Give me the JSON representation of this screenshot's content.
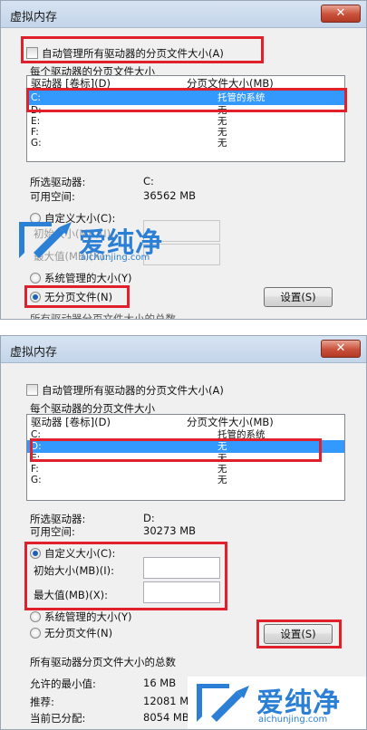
{
  "panel1": {
    "title": "虚拟内存",
    "close_glyph": "✕",
    "auto_manage_label": "自动管理所有驱动器的分页文件大小(A)",
    "group_title": "每个驱动器的分页文件大小",
    "list_head": {
      "drive": "驱动器 [卷标](D)",
      "size": "分页文件大小(MB)"
    },
    "rows": [
      {
        "drive": "C:",
        "size": "托管的系统"
      },
      {
        "drive": "D:",
        "size": "无"
      },
      {
        "drive": "E:",
        "size": "无"
      },
      {
        "drive": "F:",
        "size": "无"
      },
      {
        "drive": "G:",
        "size": "无"
      }
    ],
    "selected_drive_label": "所选驱动器:",
    "selected_drive_value": "C:",
    "free_space_label": "可用空间:",
    "free_space_value": "36562 MB",
    "custom_size_label": "自定义大小(C):",
    "initial_size_label": "初始大小(MB)(I):",
    "max_size_label": "最大值(MB)(X):",
    "system_managed_label": "系统管理的大小(Y)",
    "no_paging_label": "无分页文件(N)",
    "set_button": "设置(S)",
    "cutoff_text": "所有驱动器分页文件大小的总数"
  },
  "panel2": {
    "title": "虚拟内存",
    "close_glyph": "✕",
    "auto_manage_label": "自动管理所有驱动器的分页文件大小(A)",
    "group_title": "每个驱动器的分页文件大小",
    "list_head": {
      "drive": "驱动器 [卷标](D)",
      "size": "分页文件大小(MB)"
    },
    "rows": [
      {
        "drive": "C:",
        "size": "托管的系统"
      },
      {
        "drive": "D:",
        "size": "无"
      },
      {
        "drive": "E:",
        "size": "无"
      },
      {
        "drive": "F:",
        "size": "无"
      },
      {
        "drive": "G:",
        "size": "无"
      }
    ],
    "selected_drive_label": "所选驱动器:",
    "selected_drive_value": "D:",
    "free_space_label": "可用空间:",
    "free_space_value": "30273 MB",
    "custom_size_label": "自定义大小(C):",
    "initial_size_label": "初始大小(MB)(I):",
    "max_size_label": "最大值(MB)(X):",
    "system_managed_label": "系统管理的大小(Y)",
    "no_paging_label": "无分页文件(N)",
    "set_button": "设置(S)",
    "total_group_title": "所有驱动器分页文件大小的总数",
    "min_allowed_label": "允许的最小值:",
    "min_allowed_value": "16 MB",
    "recommended_label": "推荐:",
    "recommended_value": "12081 MB",
    "current_label": "当前已分配:",
    "current_value": "8054 MB"
  },
  "watermark": {
    "brand": "爱纯净",
    "url": "aichunjing.com"
  },
  "colors": {
    "highlight": "#e0202a",
    "selection": "#3399ff",
    "watermark_blue": "#2b7fd4"
  }
}
